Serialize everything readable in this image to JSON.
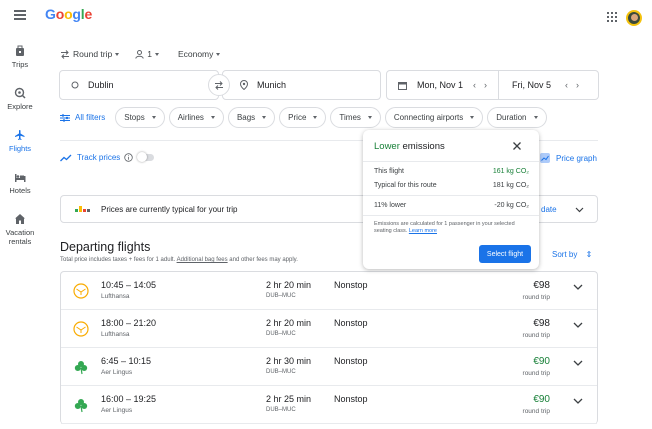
{
  "brand": {
    "logo_letters": [
      "G",
      "o",
      "o",
      "g",
      "l",
      "e"
    ],
    "logo_colors": [
      "#4285f4",
      "#ea4335",
      "#fbbc05",
      "#4285f4",
      "#34a853",
      "#ea4335"
    ]
  },
  "sidebar": {
    "items": [
      {
        "label": "Trips",
        "icon": "briefcase-icon"
      },
      {
        "label": "Explore",
        "icon": "explore-icon"
      },
      {
        "label": "Flights",
        "icon": "airplane-icon",
        "active": true
      },
      {
        "label": "Hotels",
        "icon": "bed-icon"
      },
      {
        "label": "Vacation",
        "label2": "rentals",
        "icon": "house-icon"
      }
    ]
  },
  "search": {
    "trip_type": "Round trip",
    "passengers": "1",
    "cabin": "Economy",
    "origin": "Dublin",
    "destination": "Munich",
    "depart_date": "Mon, Nov 1",
    "return_date": "Fri, Nov 5"
  },
  "filters": {
    "all_filters": "All filters",
    "chips": [
      "Stops",
      "Airlines",
      "Bags",
      "Price",
      "Times",
      "Connecting airports",
      "Duration"
    ]
  },
  "tracking": {
    "track_prices": "Track prices",
    "price_graph": "Price graph"
  },
  "insight": {
    "text": "Prices are currently typical for your trip",
    "right_text": "date"
  },
  "results": {
    "title": "Departing flights",
    "subtitle_pre": "Total price includes taxes + fees for 1 adult. ",
    "subtitle_link": "Additional bag fees",
    "subtitle_post": " and other fees may apply.",
    "sort_by": "Sort by",
    "flights": [
      {
        "times": "10:45 – 14:05",
        "airline": "Lufthansa",
        "duration": "2 hr 20 min",
        "route": "DUB–MUC",
        "stops": "Nonstop",
        "price": "€98",
        "trip": "round trip",
        "logo": "lufthansa-logo-icon",
        "price_color": "#202124"
      },
      {
        "times": "18:00 – 21:20",
        "airline": "Lufthansa",
        "duration": "2 hr 20 min",
        "route": "DUB–MUC",
        "stops": "Nonstop",
        "price": "€98",
        "trip": "round trip",
        "logo": "lufthansa-logo-icon",
        "price_color": "#202124"
      },
      {
        "times": "6:45 – 10:15",
        "airline": "Aer Lingus",
        "duration": "2 hr 30 min",
        "route": "DUB–MUC",
        "stops": "Nonstop",
        "price": "€90",
        "trip": "round trip",
        "logo": "aer-lingus-shamrock-icon",
        "price_color": "#188038"
      },
      {
        "times": "16:00 – 19:25",
        "airline": "Aer Lingus",
        "duration": "2 hr 25 min",
        "route": "DUB–MUC",
        "stops": "Nonstop",
        "price": "€90",
        "trip": "round trip",
        "logo": "aer-lingus-shamrock-icon",
        "price_color": "#188038"
      }
    ]
  },
  "emissions_popup": {
    "title_accent": "Lower",
    "title_rest": " emissions",
    "this_flight_label": "This flight",
    "this_flight_value": "161 kg CO₂",
    "typical_label": "Typical for this route",
    "typical_value": "181 kg CO₂",
    "lower_label": "11% lower",
    "lower_value": "-20 kg CO₂",
    "note": "Emissions are calculated for 1 passenger in your selected seating class. ",
    "learn_more": "Learn more",
    "select_button": "Select flight"
  },
  "colors": {
    "accent": "#1a73e8",
    "eco_green": "#188038"
  }
}
